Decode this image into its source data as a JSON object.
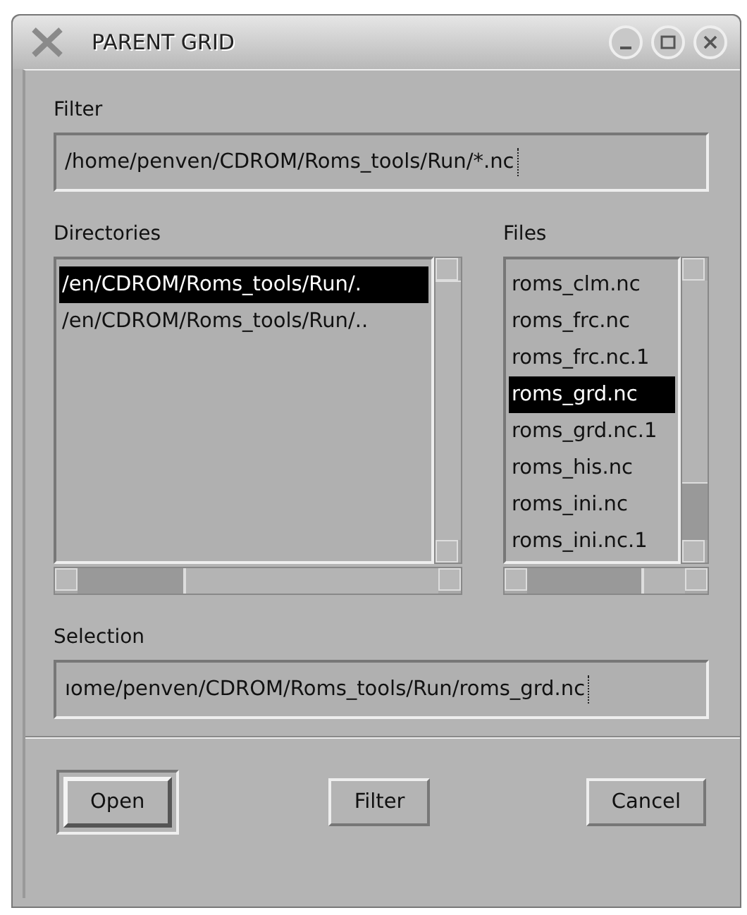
{
  "window": {
    "title": "PARENT GRID"
  },
  "filter": {
    "label": "Filter",
    "value": "/home/penven/CDROM/Roms_tools/Run/*.nc"
  },
  "directories": {
    "label": "Directories",
    "items": [
      {
        "label": "/en/CDROM/Roms_tools/Run/.",
        "selected": true
      },
      {
        "label": "/en/CDROM/Roms_tools/Run/..",
        "selected": false
      }
    ]
  },
  "files": {
    "label": "Files",
    "items": [
      {
        "label": "roms_clm.nc",
        "selected": false
      },
      {
        "label": "roms_frc.nc",
        "selected": false
      },
      {
        "label": "roms_frc.nc.1",
        "selected": false
      },
      {
        "label": "roms_grd.nc",
        "selected": true
      },
      {
        "label": "roms_grd.nc.1",
        "selected": false
      },
      {
        "label": "roms_his.nc",
        "selected": false
      },
      {
        "label": "roms_ini.nc",
        "selected": false
      },
      {
        "label": "roms_ini.nc.1",
        "selected": false
      }
    ]
  },
  "selection": {
    "label": "Selection",
    "value": "ıome/penven/CDROM/Roms_tools/Run/roms_grd.nc"
  },
  "buttons": [
    {
      "label": "Open",
      "default": true
    },
    {
      "label": "Filter",
      "default": false
    },
    {
      "label": "Cancel",
      "default": false
    }
  ]
}
